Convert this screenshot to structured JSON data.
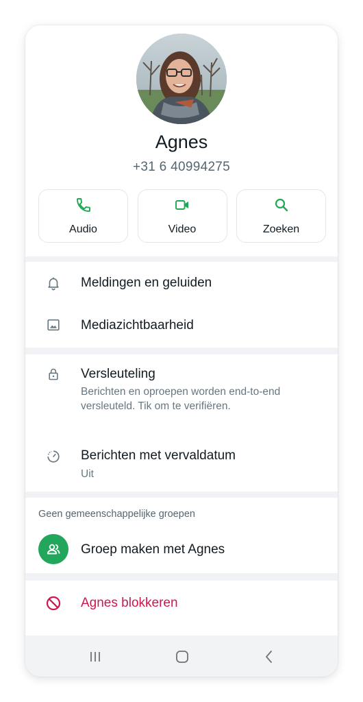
{
  "contact": {
    "name": "Agnes",
    "phone": "+31 6 40994275"
  },
  "actions": [
    {
      "label": "Audio",
      "icon": "phone-icon"
    },
    {
      "label": "Video",
      "icon": "video-icon"
    },
    {
      "label": "Zoeken",
      "icon": "search-icon"
    }
  ],
  "settings": {
    "notifications": "Meldingen en geluiden",
    "media_visibility": "Mediazichtbaarheid",
    "encryption_title": "Versleuteling",
    "encryption_sub": "Berichten en oproepen worden end-to-end versleuteld. Tik om te verifiëren.",
    "disappearing_title": "Berichten met vervaldatum",
    "disappearing_sub": "Uit"
  },
  "groups": {
    "label": "Geen gemeenschappelijke groepen",
    "create": "Groep maken met Agnes"
  },
  "block": {
    "label": "Agnes blokkeren"
  },
  "colors": {
    "accent": "#21a65b",
    "danger": "#d0164d"
  }
}
